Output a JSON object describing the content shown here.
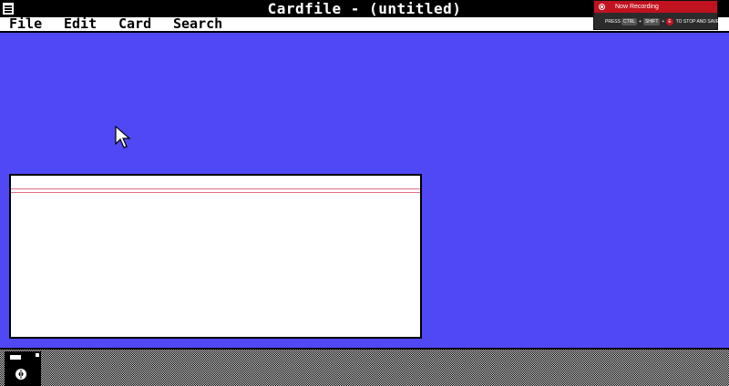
{
  "window": {
    "title": "Cardfile - (untitled)"
  },
  "menubar": {
    "items": [
      "File",
      "Edit",
      "Card",
      "Search"
    ]
  },
  "recording": {
    "title": "Now Recording",
    "hint_press": "PRESS",
    "key_ctrl": "CTRL",
    "key_shift": "SHIFT",
    "key_e": "E",
    "hint_suffix": "TO STOP AND SAVE"
  },
  "card": {
    "index_line": "",
    "body_text": ""
  },
  "icons": {
    "system_menu": "system-menu-icon",
    "cursor": "arrow-cursor-icon",
    "minimized_app": "floppy-disk-icon",
    "record": "record-icon"
  },
  "colors": {
    "desktop": "#5048f4",
    "titlebar": "#000000",
    "card_rule": "#e07080",
    "recording_header": "#c1121f"
  }
}
